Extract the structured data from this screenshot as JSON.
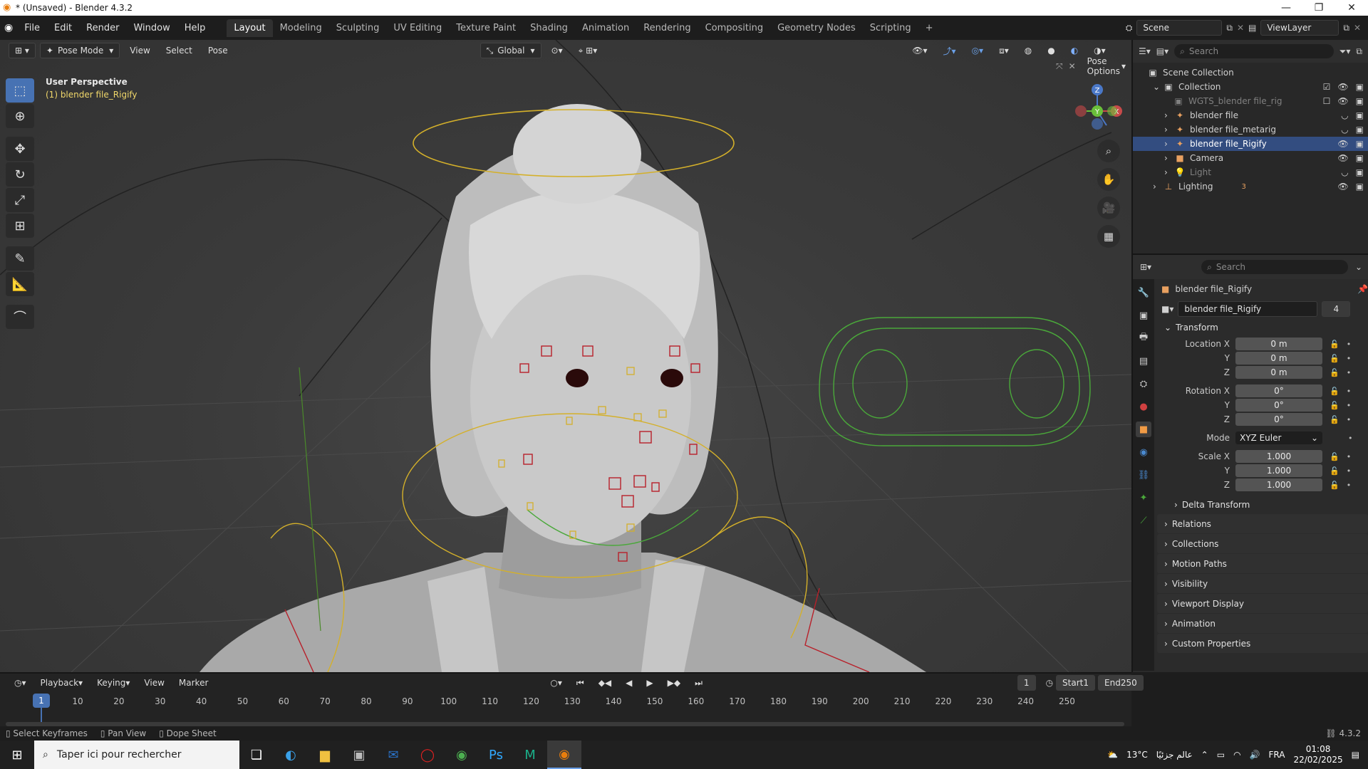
{
  "titlebar": {
    "title": "* (Unsaved) - Blender 4.3.2",
    "minimize": "—",
    "restore": "❐",
    "close": "✕"
  },
  "menu": [
    "File",
    "Edit",
    "Render",
    "Window",
    "Help"
  ],
  "workspaces": [
    "Layout",
    "Modeling",
    "Sculpting",
    "UV Editing",
    "Texture Paint",
    "Shading",
    "Animation",
    "Rendering",
    "Compositing",
    "Geometry Nodes",
    "Scripting",
    "+"
  ],
  "scene": {
    "scene_name": "Scene",
    "viewlayer": "ViewLayer"
  },
  "viewport": {
    "mode": "Pose Mode",
    "menus": [
      "View",
      "Select",
      "Pose"
    ],
    "orientation": "Global",
    "perspective_label": "User Perspective",
    "object_label": "(1) blender file_Rigify",
    "pose_options": "Pose Options",
    "gizmo": {
      "x": "X",
      "y": "Y",
      "z": "Z"
    }
  },
  "outliner": {
    "search_placeholder": "Search",
    "rows": [
      {
        "label": "Scene Collection"
      },
      {
        "label": "Collection"
      },
      {
        "label": "WGTS_blender file_rig"
      },
      {
        "label": "blender file"
      },
      {
        "label": "blender file_metarig"
      },
      {
        "label": "blender file_Rigify"
      },
      {
        "label": "Camera"
      },
      {
        "label": "Light"
      },
      {
        "label": "Lighting"
      }
    ],
    "lighting_count": "3"
  },
  "properties": {
    "search_placeholder": "Search",
    "object_name": "blender file_Rigify",
    "data_name": "blender file_Rigify",
    "users": "4",
    "transform_label": "Transform",
    "location": {
      "label_x": "Location X",
      "label_y": "Y",
      "label_z": "Z",
      "x": "0 m",
      "y": "0 m",
      "z": "0 m"
    },
    "rotation": {
      "label_x": "Rotation X",
      "label_y": "Y",
      "label_z": "Z",
      "x": "0°",
      "y": "0°",
      "z": "0°"
    },
    "mode_label": "Mode",
    "mode_value": "XYZ Euler",
    "scale": {
      "label_x": "Scale X",
      "label_y": "Y",
      "label_z": "Z",
      "x": "1.000",
      "y": "1.000",
      "z": "1.000"
    },
    "sections": [
      "Delta Transform",
      "Relations",
      "Collections",
      "Motion Paths",
      "Visibility",
      "Viewport Display",
      "Animation",
      "Custom Properties"
    ]
  },
  "timeline": {
    "menus": [
      "Playback",
      "Keying",
      "View",
      "Marker"
    ],
    "current_frame": "1",
    "start_label": "Start",
    "start": "1",
    "end_label": "End",
    "end": "250",
    "ticks": [
      "10",
      "20",
      "30",
      "40",
      "50",
      "60",
      "70",
      "80",
      "90",
      "100",
      "110",
      "120",
      "130",
      "140",
      "150",
      "160",
      "170",
      "180",
      "190",
      "200",
      "210",
      "220",
      "230",
      "240",
      "250"
    ]
  },
  "statusbar": {
    "items": [
      "Select Keyframes",
      "Pan View",
      "Dope Sheet"
    ],
    "version": "4.3.2"
  },
  "taskbar": {
    "search_placeholder": "Taper ici pour rechercher",
    "weather": "13°C",
    "weather_text": "عالم جزئيًا",
    "language": "FRA",
    "time": "01:08",
    "date": "22/02/2025"
  },
  "colors": {
    "accent": "#4772b3",
    "selected_row": "#334d80",
    "bone_yellow": "#d4b02a",
    "bone_green": "#4aa83a",
    "bone_red": "#b8202a",
    "object_label": "#f0d76a"
  }
}
